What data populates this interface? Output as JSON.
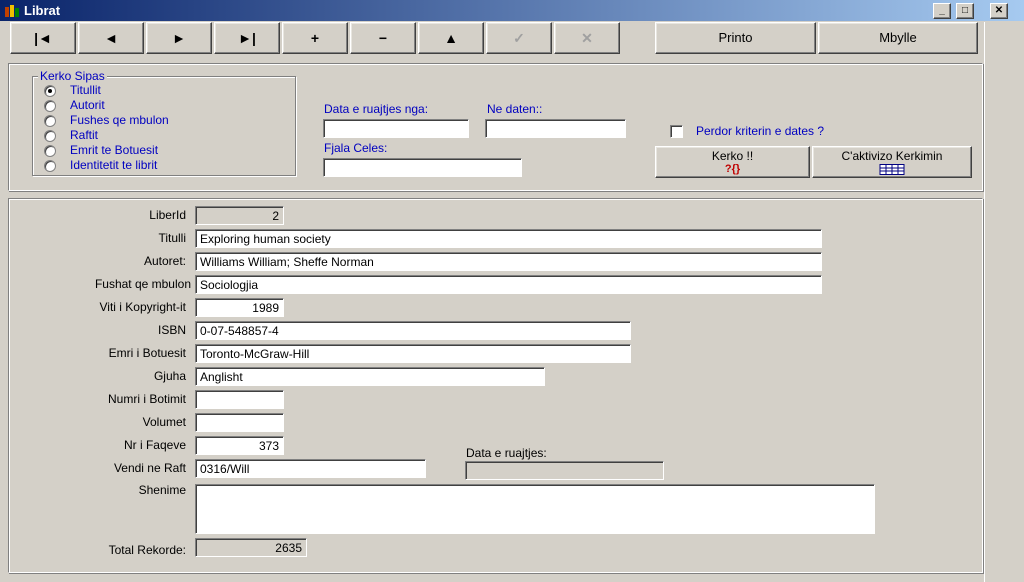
{
  "window": {
    "title": "Librat"
  },
  "caption_buttons": {
    "minimize": "_",
    "maximize": "□",
    "close": "✕"
  },
  "toolbar": {
    "first": "|◄",
    "prev": "◄",
    "next": "►",
    "last": "►|",
    "add": "+",
    "delete": "−",
    "up": "▲",
    "confirm": "✓",
    "cancel": "✕",
    "print_label": "Printo",
    "close_label": "Mbylle"
  },
  "search": {
    "group_title": "Kerko Sipas",
    "options": [
      {
        "label": "Titullit",
        "checked": true
      },
      {
        "label": "Autorit",
        "checked": false
      },
      {
        "label": "Fushes qe mbulon",
        "checked": false
      },
      {
        "label": "Raftit",
        "checked": false
      },
      {
        "label": "Emrit te Botuesit",
        "checked": false
      },
      {
        "label": "Identitetit te librit",
        "checked": false
      }
    ],
    "date_from_label": "Data e ruajtjes nga:",
    "date_to_label": "Ne daten::",
    "date_from_value": "",
    "date_to_value": "",
    "keyword_label": "Fjala Celes:",
    "keyword_value": "",
    "use_dates_label": "Perdor kriterin e dates ?",
    "use_dates_checked": false,
    "search_button": "Kerko !!",
    "search_button_icon": "?{}",
    "deactivate_button": "C'aktivizo Kerkimin"
  },
  "record": {
    "liber_id_label": "LiberId",
    "liber_id": "2",
    "titulli_label": "Titulli",
    "titulli": "Exploring human society",
    "autoret_label": "Autoret:",
    "autoret": "Williams William; Sheffe Norman",
    "fushat_label": "Fushat qe mbulon",
    "fushat": "Sociologjia",
    "viti_label": "Viti i Kopyright-it",
    "viti": "1989",
    "isbn_label": "ISBN",
    "isbn": "0-07-548857-4",
    "botues_label": "Emri i Botuesit",
    "botues": "Toronto-McGraw-Hill",
    "gjuha_label": "Gjuha",
    "gjuha": "Anglisht",
    "numri_botimit_label": "Numri i Botimit",
    "numri_botimit": "",
    "volumet_label": "Volumet",
    "volumet": "",
    "faqe_label": "Nr i Faqeve",
    "faqe": "373",
    "vendi_label": "Vendi ne Raft",
    "vendi": "0316/Will",
    "data_ruajtjes_label": "Data e ruajtjes:",
    "data_ruajtjes": "",
    "shenime_label": "Shenime",
    "shenime": "",
    "total_label": "Total Rekorde:",
    "total": "2635"
  }
}
